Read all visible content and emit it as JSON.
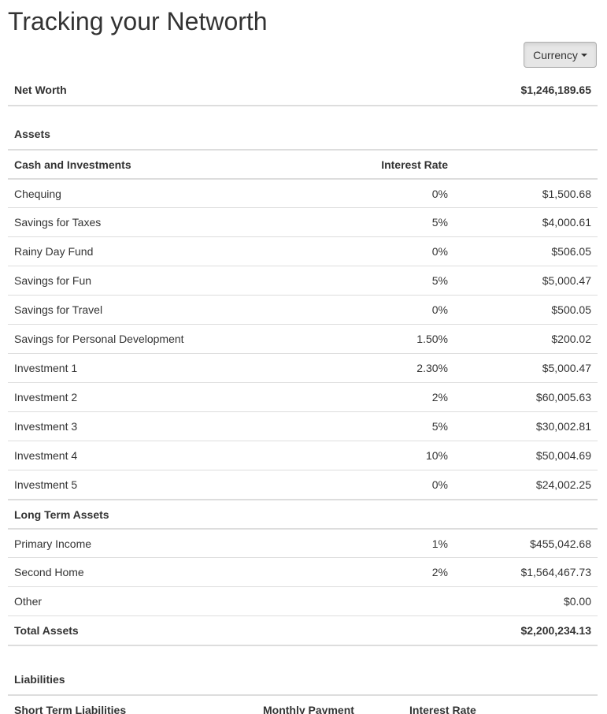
{
  "page": {
    "title": "Tracking your Networth",
    "currency_label": "Currency"
  },
  "networth": {
    "label": "Net Worth",
    "value": "$1,246,189.65"
  },
  "assets": {
    "section_label": "Assets",
    "cash_header": {
      "name": "Cash and Investments",
      "rate": "Interest Rate"
    },
    "cash_rows": [
      {
        "name": "Chequing",
        "rate": "0%",
        "amount": "$1,500.68"
      },
      {
        "name": "Savings for Taxes",
        "rate": "5%",
        "amount": "$4,000.61"
      },
      {
        "name": "Rainy Day Fund",
        "rate": "0%",
        "amount": "$506.05"
      },
      {
        "name": "Savings for Fun",
        "rate": "5%",
        "amount": "$5,000.47"
      },
      {
        "name": "Savings for Travel",
        "rate": "0%",
        "amount": "$500.05"
      },
      {
        "name": "Savings for Personal Development",
        "rate": "1.50%",
        "amount": "$200.02"
      },
      {
        "name": "Investment 1",
        "rate": "2.30%",
        "amount": "$5,000.47"
      },
      {
        "name": "Investment 2",
        "rate": "2%",
        "amount": "$60,005.63"
      },
      {
        "name": "Investment 3",
        "rate": "5%",
        "amount": "$30,002.81"
      },
      {
        "name": "Investment 4",
        "rate": "10%",
        "amount": "$50,004.69"
      },
      {
        "name": "Investment 5",
        "rate": "0%",
        "amount": "$24,002.25"
      }
    ],
    "long_term_header": "Long Term Assets",
    "long_term_rows": [
      {
        "name": "Primary Income",
        "rate": "1%",
        "amount": "$455,042.68"
      },
      {
        "name": "Second Home",
        "rate": "2%",
        "amount": "$1,564,467.73"
      },
      {
        "name": "Other",
        "rate": "",
        "amount": "$0.00"
      }
    ],
    "total_label": "Total Assets",
    "total_value": "$2,200,234.13"
  },
  "liabilities": {
    "section_label": "Liabilities",
    "short_term_header": {
      "name": "Short Term Liabilities",
      "payment": "Monthly Payment",
      "rate": "Interest Rate"
    }
  }
}
